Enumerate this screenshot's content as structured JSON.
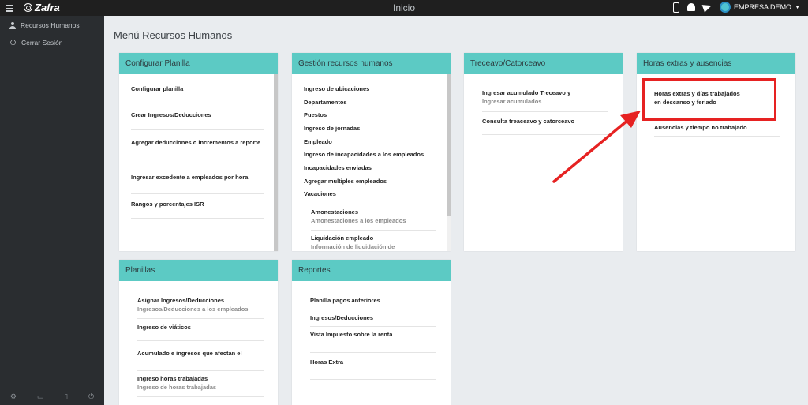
{
  "app": {
    "brand": "Zafra",
    "title": "Inicio",
    "company": "EMPRESA DEMO"
  },
  "sidebar": {
    "items": [
      {
        "label": "Recursos Humanos",
        "icon": "user-icon"
      },
      {
        "label": "Cerrar Sesión",
        "icon": "power-icon"
      }
    ],
    "footer_icons": [
      "gear-icon",
      "monitor-icon",
      "lock-icon",
      "power-icon"
    ]
  },
  "page": {
    "title": "Menú Recursos Humanos"
  },
  "cards": {
    "configurar": {
      "title": "Configurar Planilla",
      "items": [
        {
          "label": "Configurar planilla"
        },
        {
          "label": "Crear Ingresos/Deducciones"
        },
        {
          "label": "Agregar deducciones o incrementos a reporte"
        },
        {
          "label": "Ingresar excedente a empleados por hora"
        },
        {
          "label": "Rangos y porcentajes ISR"
        }
      ]
    },
    "gestion": {
      "title": "Gestión recursos humanos",
      "items": [
        {
          "label": "Ingreso de ubicaciones"
        },
        {
          "label": "Departamentos"
        },
        {
          "label": "Puestos"
        },
        {
          "label": "Ingreso de jornadas"
        },
        {
          "label": "Empleado"
        },
        {
          "label": "Ingreso de incapacidades a los empleados"
        },
        {
          "label": "Incapacidades enviadas"
        },
        {
          "label": "Agregar multiples empleados"
        },
        {
          "label": "Vacaciones"
        }
      ],
      "subitems": [
        {
          "label": "Amonestaciones",
          "sub": "Amonestaciones a los empleados"
        },
        {
          "label": "Liquidación empleado",
          "sub": "Información de liquidación de"
        }
      ]
    },
    "treceavo": {
      "title": "Treceavo/Catorceavo",
      "items": [
        {
          "label": "Ingresar acumulado Treceavo y",
          "sub": "Ingresar acumulados"
        },
        {
          "label": "Consulta treaceavo y catorceavo"
        }
      ]
    },
    "horas": {
      "title": "Horas extras y ausencias",
      "items": [
        {
          "label": "Horas extras y días trabajados",
          "label2": "en descanso y feriado"
        },
        {
          "label": "Ausencias y tiempo no trabajado"
        }
      ]
    },
    "planillas": {
      "title": "Planillas",
      "items": [
        {
          "label": "Asignar Ingresos/Deducciones",
          "sub": "Ingresos/Deducciones a los empleados"
        },
        {
          "label": "Ingreso de viáticos"
        },
        {
          "label": "Acumulado e ingresos que afectan el"
        },
        {
          "label": "Ingreso horas trabajadas",
          "sub": "Ingreso de horas trabajadas"
        }
      ]
    },
    "reportes": {
      "title": "Reportes",
      "items": [
        {
          "label": "Planilla pagos anteriores"
        },
        {
          "label": "Ingresos/Deducciones"
        },
        {
          "label": "Vista Impuesto sobre la renta"
        },
        {
          "label": "Horas Extra"
        }
      ]
    }
  },
  "colors": {
    "header": "#5ccac4",
    "topbar": "#1f1f1f",
    "sidebar": "#2a2d30",
    "highlight": "#e62222"
  }
}
